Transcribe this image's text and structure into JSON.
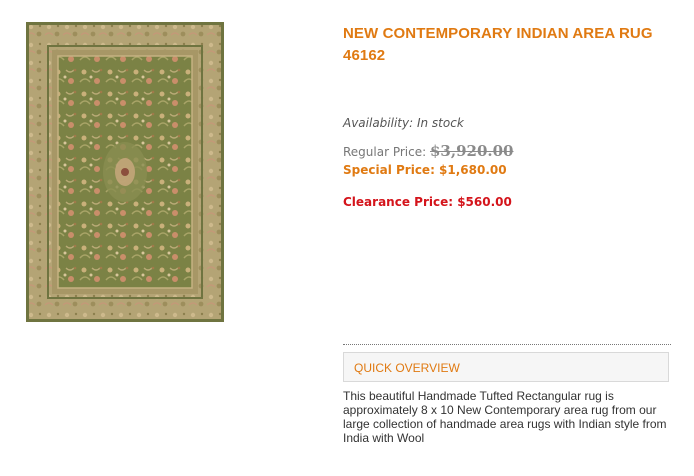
{
  "product": {
    "title": "NEW CONTEMPORARY INDIAN AREA RUG 46162",
    "availability": "Availability: In stock",
    "regular_price_label": "Regular Price:",
    "regular_price_value": "$3,920.00",
    "special_price": "Special Price: $1,680.00",
    "clearance_price": "Clearance Price: $560.00",
    "overview_tab_label": "QUICK OVERVIEW",
    "description": "This beautiful Handmade Tufted Rectangular rug is approximately 8 x 10 New Contemporary area rug from our large collection of handmade area rugs with Indian style from India with Wool"
  },
  "colors": {
    "accent_orange": "#e07a12",
    "clearance_red": "#d4141b",
    "rug_field_green": "#7d8447",
    "rug_border_tan": "#b7a879"
  },
  "icons": [
    "rug-product-image"
  ]
}
